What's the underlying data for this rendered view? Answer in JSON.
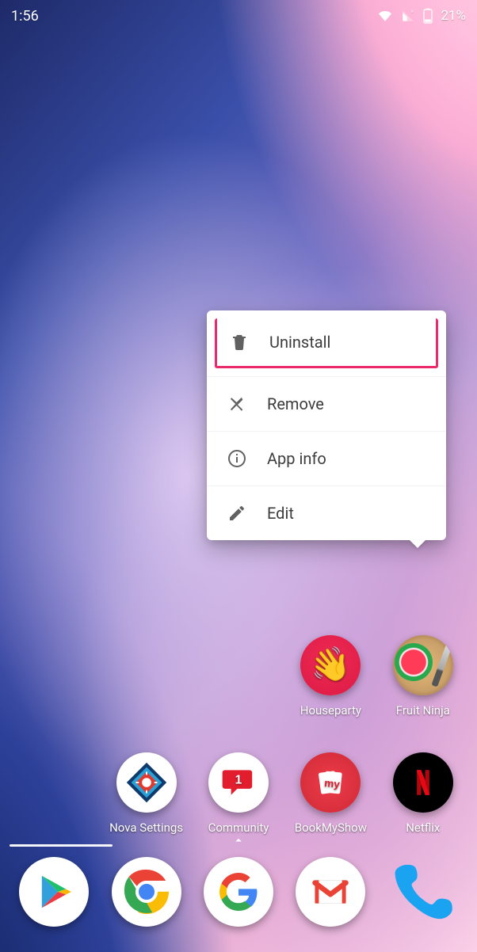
{
  "status": {
    "time": "1:56",
    "battery_percent": "21%",
    "icons": {
      "wifi": "wifi-icon",
      "cell": "cell-signal-no-data-icon",
      "battery": "battery-icon"
    }
  },
  "popup": {
    "items": [
      {
        "id": "uninstall",
        "label": "Uninstall",
        "icon": "trash-icon",
        "highlighted": true
      },
      {
        "id": "remove",
        "label": "Remove",
        "icon": "close-icon",
        "highlighted": false
      },
      {
        "id": "appinfo",
        "label": "App info",
        "icon": "info-icon",
        "highlighted": false
      },
      {
        "id": "edit",
        "label": "Edit",
        "icon": "pencil-icon",
        "highlighted": false
      }
    ]
  },
  "apps_row1": [
    {
      "slot": 4,
      "id": "houseparty",
      "label": "Houseparty",
      "icon": "houseparty-icon"
    },
    {
      "slot": 5,
      "id": "fruitninja",
      "label": "Fruit Ninja",
      "icon": "fruit-ninja-icon"
    }
  ],
  "apps_row2": [
    {
      "slot": 2,
      "id": "novasettings",
      "label": "Nova Settings",
      "icon": "nova-settings-icon"
    },
    {
      "slot": 3,
      "id": "community",
      "label": "Community",
      "icon": "community-icon"
    },
    {
      "slot": 4,
      "id": "bookmyshow",
      "label": "BookMyShow",
      "icon": "bookmyshow-icon"
    },
    {
      "slot": 5,
      "id": "netflix",
      "label": "Netflix",
      "icon": "netflix-icon"
    }
  ],
  "dock": [
    {
      "id": "playstore",
      "icon": "play-store-icon"
    },
    {
      "id": "chrome",
      "icon": "chrome-icon"
    },
    {
      "id": "google",
      "icon": "google-icon"
    },
    {
      "id": "gmail",
      "icon": "gmail-icon"
    },
    {
      "id": "phone",
      "icon": "phone-icon"
    }
  ],
  "colors": {
    "popup_highlight": "#eb2a6e",
    "text_dark": "#3c3c3c"
  }
}
